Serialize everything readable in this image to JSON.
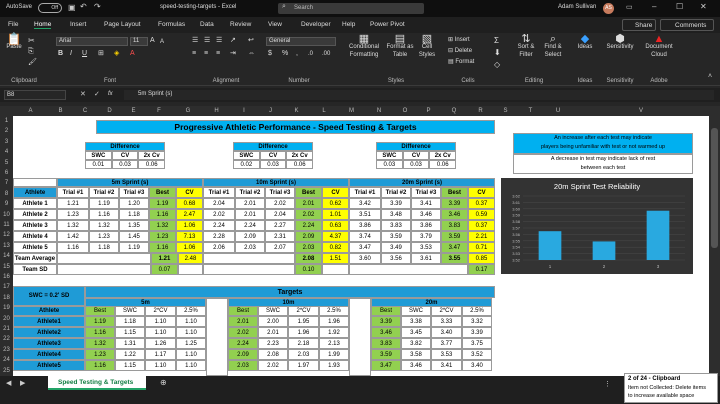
{
  "title": {
    "autosave_label": "AutoSave",
    "autosave_state": "Off",
    "doc_name": "speed-testing-targets - Excel",
    "search_placeholder": "Search",
    "user_name": "Adam Sullivan",
    "user_initials": "AS"
  },
  "menu": [
    "File",
    "Home",
    "Insert",
    "Page Layout",
    "Formulas",
    "Data",
    "Review",
    "View",
    "Developer",
    "Help",
    "Power Pivot"
  ],
  "share_label": "Share",
  "comments_label": "Comments",
  "ribbon": {
    "groups": [
      "Clipboard",
      "Font",
      "Alignment",
      "Number",
      "Styles",
      "Cells",
      "Editing",
      "Ideas",
      "Sensitivity",
      "Adobe"
    ],
    "paste": "Paste",
    "font_name": "Arial",
    "font_size": "11",
    "number_format": "General",
    "conditional": "Conditional Formatting",
    "format_table": "Format as Table",
    "cell_styles": "Cell Styles",
    "insert": "Insert",
    "delete": "Delete",
    "format": "Format",
    "sort": "Sort & Filter",
    "find": "Find & Select",
    "ideas": "Ideas",
    "sensitivity": "Sensitivity",
    "pdf": "Document Cloud"
  },
  "formula_bar": {
    "name_box": "B8",
    "fx": "fx",
    "content": "5m Sprint (s)"
  },
  "columns": [
    "A",
    "B",
    "C",
    "D",
    "E",
    "F",
    "G",
    "H",
    "I",
    "J",
    "K",
    "L",
    "M",
    "N",
    "O",
    "P",
    "Q",
    "R",
    "S",
    "T",
    "U",
    "V"
  ],
  "rows": [
    "1",
    "2",
    "3",
    "4",
    "5",
    "6",
    "7",
    "8",
    "9",
    "10",
    "11",
    "12",
    "13",
    "14",
    "15",
    "16",
    "17",
    "18",
    "19",
    "20",
    "21",
    "22",
    "23",
    "24",
    "25"
  ],
  "sheet": {
    "main_title": "Progressive Athletic Performance - Speed Testing & Targets",
    "diff_blocks": [
      {
        "title": "Difference",
        "headers": [
          "SWC",
          "CV",
          "2x Cv"
        ],
        "values": [
          "0.01",
          "0.03",
          "0.06"
        ]
      },
      {
        "title": "Difference",
        "headers": [
          "SWC",
          "CV",
          "2x Cv"
        ],
        "values": [
          "0.02",
          "0.03",
          "0.06"
        ]
      },
      {
        "title": "Difference",
        "headers": [
          "SWC",
          "CV",
          "2x Cv"
        ],
        "values": [
          "0.03",
          "0.03",
          "0.06"
        ]
      }
    ],
    "legend_lines": [
      "An increase after each test may indicate",
      "players being unfamiliar with test or not warmed up",
      "A decrease in test may indicate lack of rest",
      "between each test"
    ],
    "sprint_titles": [
      "5m Sprint (s)",
      "10m Sprint (s)",
      "20m Sprint (s)"
    ],
    "athlete_header": "Athlete",
    "trial_headers": [
      "Trial #1",
      "Trial #2",
      "Trial #3",
      "Best",
      "CV"
    ],
    "athletes": [
      "Athlete 1",
      "Athlete 2",
      "Athlete 3",
      "Athlete 4",
      "Athlete 5"
    ],
    "data5": [
      [
        "1.21",
        "1.19",
        "1.20",
        "1.19",
        "0.68"
      ],
      [
        "1.23",
        "1.16",
        "1.18",
        "1.16",
        "2.47"
      ],
      [
        "1.32",
        "1.32",
        "1.35",
        "1.32",
        "1.06"
      ],
      [
        "1.42",
        "1.23",
        "1.45",
        "1.23",
        "7.13"
      ],
      [
        "1.16",
        "1.18",
        "1.19",
        "1.16",
        "1.06"
      ]
    ],
    "data10": [
      [
        "2.04",
        "2.01",
        "2.02",
        "2.01",
        "0.62"
      ],
      [
        "2.02",
        "2.01",
        "2.04",
        "2.02",
        "1.01"
      ],
      [
        "2.24",
        "2.24",
        "2.27",
        "2.24",
        "0.63"
      ],
      [
        "2.28",
        "2.09",
        "2.31",
        "2.09",
        "4.37"
      ],
      [
        "2.06",
        "2.03",
        "2.07",
        "2.03",
        "0.82"
      ]
    ],
    "data20": [
      [
        "3.42",
        "3.39",
        "3.41",
        "3.39",
        "0.37"
      ],
      [
        "3.51",
        "3.48",
        "3.46",
        "3.46",
        "0.59"
      ],
      [
        "3.86",
        "3.83",
        "3.86",
        "3.83",
        "0.37"
      ],
      [
        "3.74",
        "3.59",
        "3.79",
        "3.59",
        "2.21"
      ],
      [
        "3.47",
        "3.49",
        "3.53",
        "3.47",
        "0.71"
      ]
    ],
    "team_avg_label": "Team Average",
    "team_avg5": [
      "1.21",
      "2.48"
    ],
    "team_avg10": [
      "2.08",
      "1.51"
    ],
    "team_avg20": [
      "3.60",
      "3.56",
      "3.61",
      "3.55",
      "0.85"
    ],
    "team_sd_label": "Team SD",
    "team_sd5": "0.07",
    "team_sd10": "0.10",
    "team_sd20": "0.17",
    "swc_label": "SWC = 0.2' SD",
    "targets_title": "Targets",
    "target_dists": [
      "5m",
      "10m",
      "20m"
    ],
    "target_headers": [
      "Best",
      "SWC",
      "2*CV",
      "2.5%"
    ],
    "target_athletes": [
      "Athlete1",
      "Athlete2",
      "Athlete3",
      "Athlete4",
      "Athlete5"
    ],
    "t5": [
      [
        "1.19",
        "1.18",
        "1.10",
        "1.10"
      ],
      [
        "1.16",
        "1.15",
        "1.10",
        "1.10"
      ],
      [
        "1.32",
        "1.31",
        "1.26",
        "1.25"
      ],
      [
        "1.23",
        "1.22",
        "1.17",
        "1.10"
      ],
      [
        "1.16",
        "1.15",
        "1.10",
        "1.10"
      ]
    ],
    "t10": [
      [
        "2.01",
        "2.00",
        "1.95",
        "1.96"
      ],
      [
        "2.02",
        "2.01",
        "1.96",
        "1.92"
      ],
      [
        "2.24",
        "2.23",
        "2.18",
        "2.13"
      ],
      [
        "2.09",
        "2.08",
        "2.03",
        "1.99"
      ],
      [
        "2.03",
        "2.02",
        "1.97",
        "1.93"
      ]
    ],
    "t20": [
      [
        "3.39",
        "3.38",
        "3.33",
        "3.32"
      ],
      [
        "3.46",
        "3.45",
        "3.40",
        "3.39"
      ],
      [
        "3.83",
        "3.82",
        "3.77",
        "3.75"
      ],
      [
        "3.59",
        "3.58",
        "3.53",
        "3.52"
      ],
      [
        "3.47",
        "3.46",
        "3.41",
        "3.40"
      ]
    ]
  },
  "chart_data": {
    "type": "bar",
    "title": "20m Sprint Test Reliability",
    "categories": [
      "1",
      "2",
      "3"
    ],
    "values": [
      3.565,
      3.549,
      3.597
    ],
    "ylim": [
      3.52,
      3.62
    ],
    "ticks": [
      "3.62",
      "3.61",
      "3.60",
      "3.59",
      "3.58",
      "3.57",
      "3.56",
      "3.55",
      "3.54",
      "3.53",
      "3.52"
    ],
    "color": "#29a9e0",
    "background": "#333333"
  },
  "status": {
    "sheet_tab": "Speed Testing & Targets",
    "clipboard_title": "2 of 24 - Clipboard",
    "clipboard_msg1": "Item not Collected: Delete items",
    "clipboard_msg2": "to increase available space"
  },
  "colors": {
    "blue": "#1f9bd6",
    "green": "#92d050",
    "yellow": "#ffff00",
    "lightblue": "#00b0f0"
  }
}
